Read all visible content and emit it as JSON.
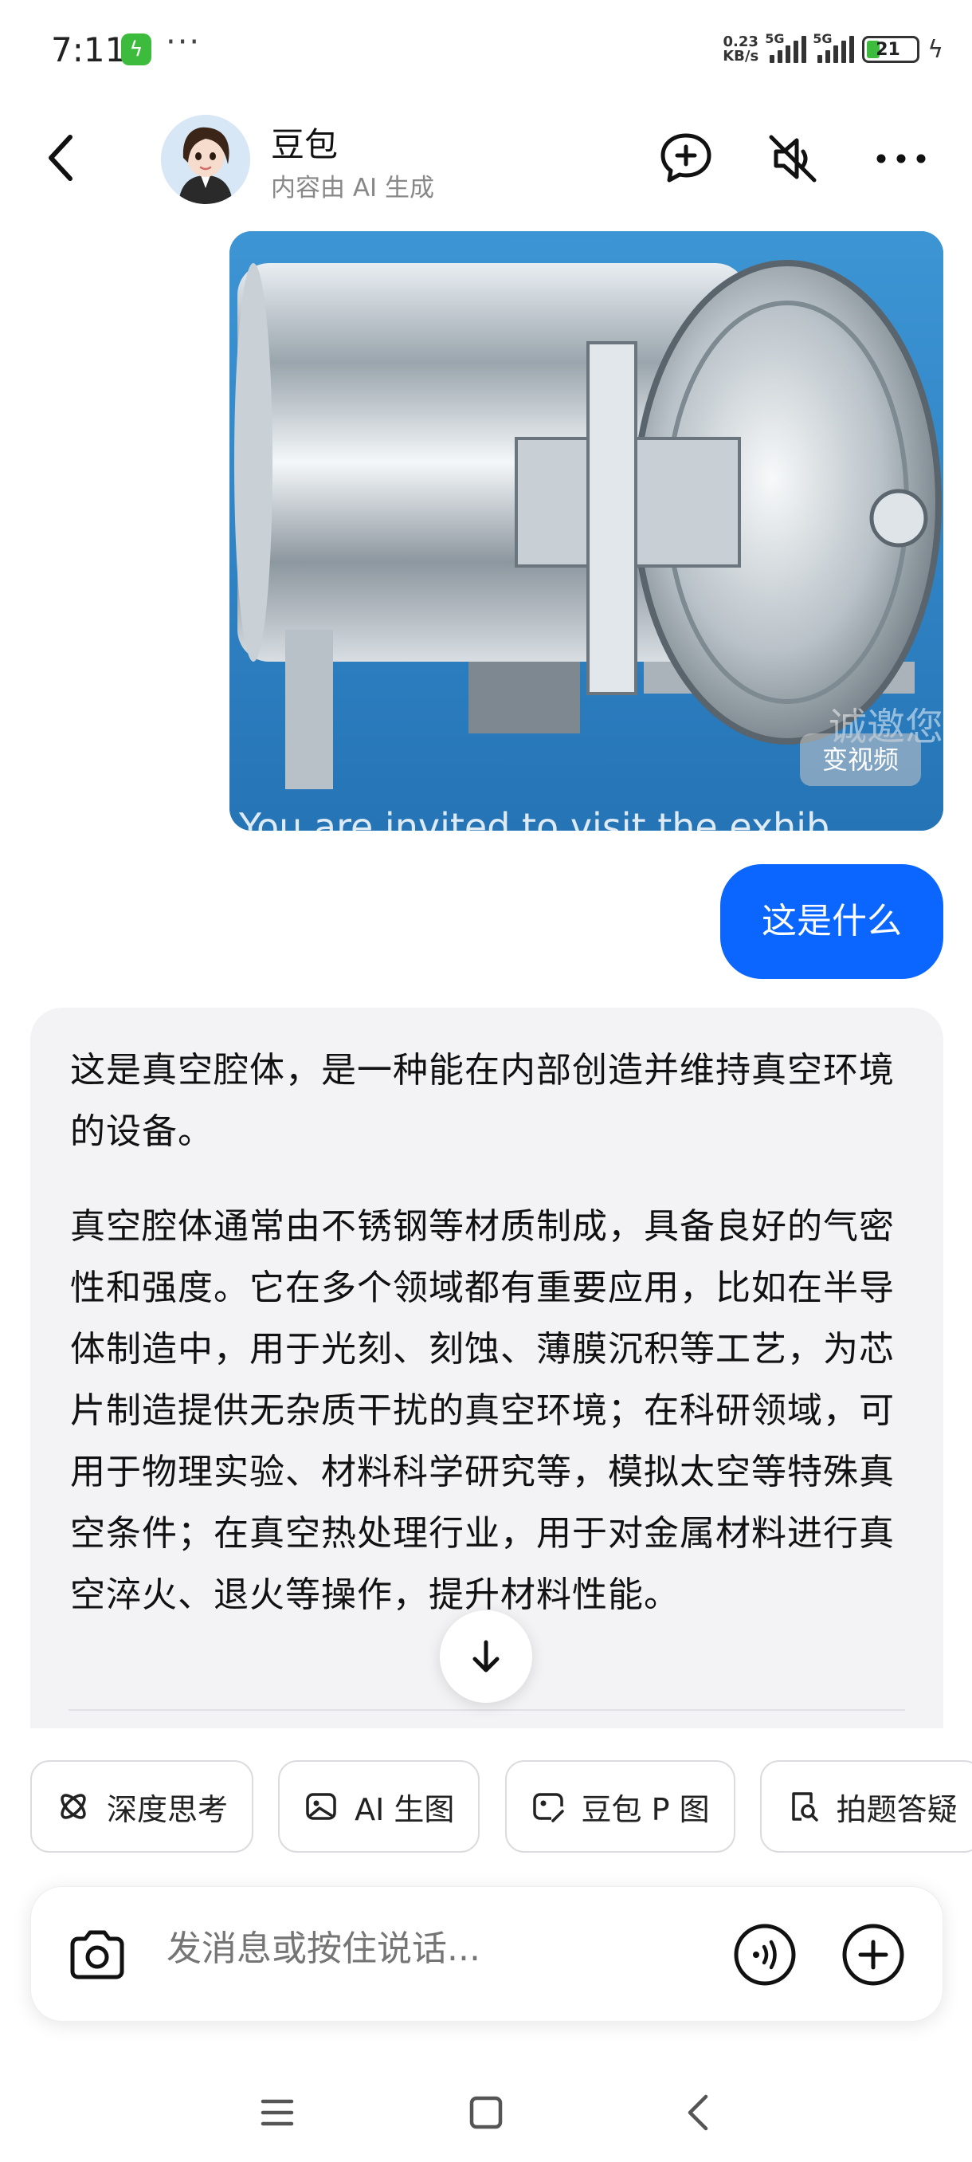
{
  "status_bar": {
    "time": "7:11",
    "dots": "···",
    "speed_top": "0.23",
    "speed_unit": "KB/s",
    "network1": "5G",
    "network2": "5G",
    "battery": "21"
  },
  "header": {
    "name": "豆包",
    "subtitle": "内容由 AI 生成"
  },
  "image_message": {
    "badge": "变视频",
    "overlay_text": "You are invited to visit the exhib",
    "watermark": "诚邀您"
  },
  "user_message": "这是什么",
  "ai_message": {
    "paragraphs": [
      "这是真空腔体，是一种能在内部创造并维持真空环境的设备。",
      "真空腔体通常由不锈钢等材质制成，具备良好的气密性和强度。它在多个领域都有重要应用，比如在半导体制造中，用于光刻、刻蚀、薄膜沉积等工艺，为芯片制造提供无杂质干扰的真空环境；在科研领域，可用于物理实验、材料科学研究等，模拟太空等特殊真空条件；在真空热处理行业，用于对金属材料进行真空淬火、退火等操作，提升材料性能。"
    ]
  },
  "chips": [
    "深度思考",
    "AI 生图",
    "豆包 P 图",
    "拍题答疑"
  ],
  "input": {
    "placeholder": "发消息或按住说话..."
  },
  "colors": {
    "accent": "#0a66ff",
    "bubble_bg": "#f3f3f5"
  }
}
